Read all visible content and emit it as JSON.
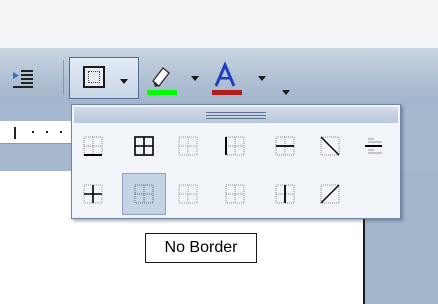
{
  "toolbar": {
    "buttons": [
      {
        "name": "increase-indent",
        "icon": "increase-indent-icon"
      },
      {
        "name": "borders",
        "icon": "no-border-icon",
        "state": "pressed"
      },
      {
        "name": "highlight",
        "icon": "highlighter-icon",
        "color": "#00ff00"
      },
      {
        "name": "font-color",
        "icon": "font-color-icon",
        "color": "#b01c1c"
      }
    ]
  },
  "borders_panel": {
    "options": [
      {
        "name": "bottom-border"
      },
      {
        "name": "all-borders"
      },
      {
        "name": "top-border"
      },
      {
        "name": "left-border"
      },
      {
        "name": "inside-horizontal-border"
      },
      {
        "name": "diagonal-down-border"
      },
      {
        "name": "horizontal-line"
      },
      {
        "name": "inside-borders"
      },
      {
        "name": "no-border",
        "selected": true
      },
      {
        "name": "outside-borders"
      },
      {
        "name": "right-border"
      },
      {
        "name": "inside-vertical-border"
      },
      {
        "name": "diagonal-up-border"
      }
    ]
  },
  "tooltip": {
    "text": "No Border"
  },
  "colors": {
    "toolbar": "#b7c6d8",
    "panel": "#f1f4f8",
    "selection": "#c6d3e6"
  }
}
